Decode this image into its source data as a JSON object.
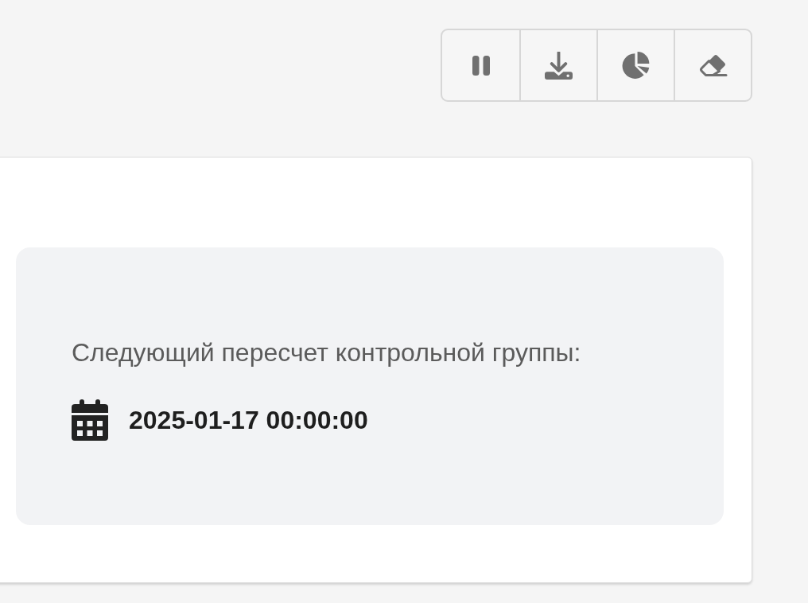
{
  "toolbar": {
    "buttons": [
      {
        "kind": "pause"
      },
      {
        "kind": "download"
      },
      {
        "kind": "pie"
      },
      {
        "kind": "eraser"
      }
    ]
  },
  "card": {
    "schedule": {
      "label": "Следующий пересчет контрольной группы:",
      "date": "2025-01-17 00:00:00"
    }
  }
}
